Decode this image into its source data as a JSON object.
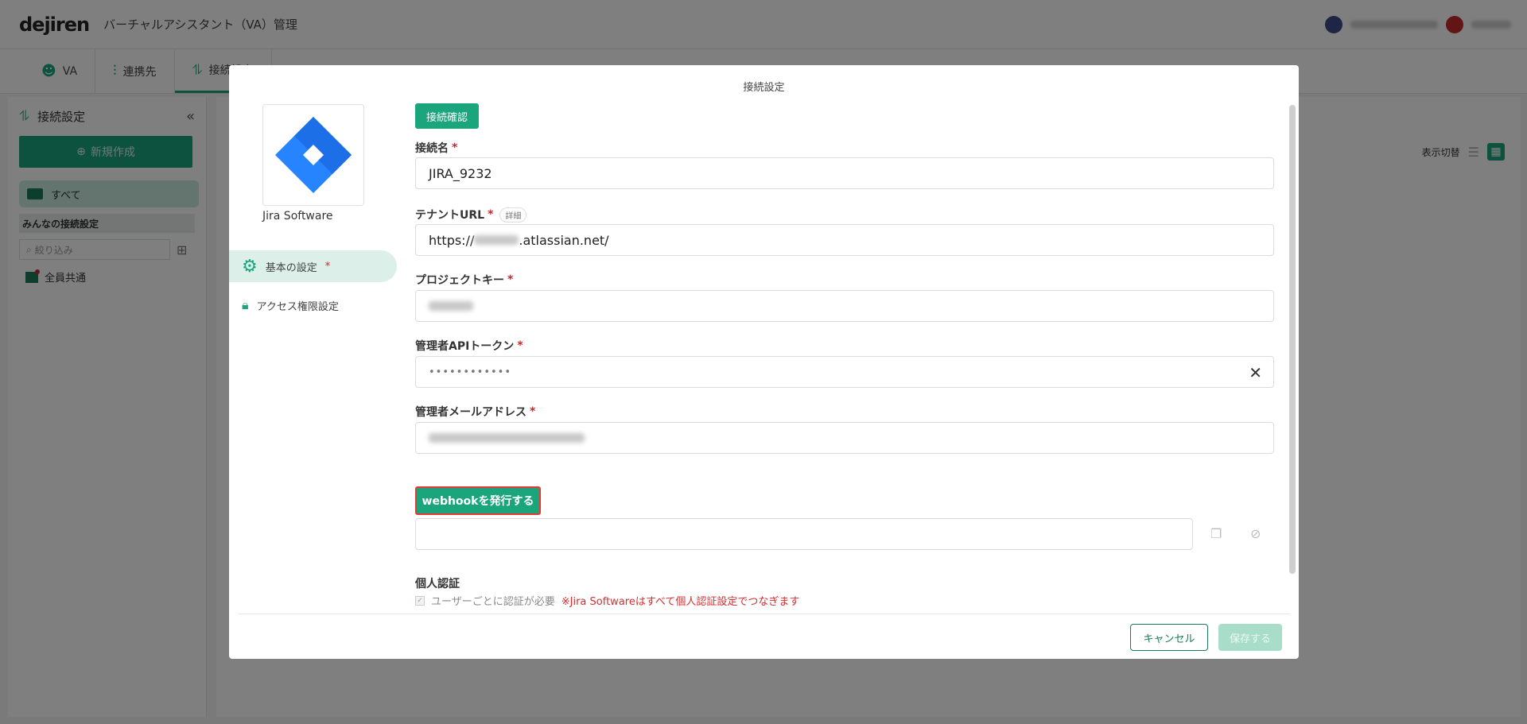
{
  "app": {
    "logo": "dejiren",
    "title": "バーチャルアシスタント（VA）管理"
  },
  "tabs": [
    {
      "label": "VA"
    },
    {
      "label": "連携先"
    },
    {
      "label": "接続設定"
    }
  ],
  "sidebar": {
    "title": "接続設定",
    "new_button": "新規作成",
    "all_label": "すべて",
    "section": "みんなの接続設定",
    "filter_placeholder": "絞り込み",
    "items": [
      {
        "label": "全員共通"
      }
    ]
  },
  "content": {
    "view_switch_label": "表示切替"
  },
  "modal": {
    "title": "接続設定",
    "service_name": "Jira Software",
    "nav": [
      {
        "label": "基本の設定",
        "required": "*"
      },
      {
        "label": "アクセス権限設定"
      }
    ],
    "confirm_button": "接続確認",
    "fields": {
      "connection_name": {
        "label": "接続名",
        "value": "JIRA_9232"
      },
      "tenant_url": {
        "label": "テナントURL",
        "detail": "詳細",
        "prefix": "https://",
        "suffix": ".atlassian.net/"
      },
      "project_key": {
        "label": "プロジェクトキー"
      },
      "api_token": {
        "label": "管理者APIトークン",
        "value": "••••••••••••"
      },
      "admin_email": {
        "label": "管理者メールアドレス"
      }
    },
    "required_mark": "*",
    "webhook_button": "webhookを発行する",
    "personal_auth": {
      "label": "個人認証",
      "checkbox_label": "ユーザーごとに認証が必要",
      "note": "※Jira Softwareはすべて個人認証設定でつなぎます"
    },
    "cancel_button": "キャンセル",
    "save_button": "保存する"
  },
  "colors": {
    "accent": "#1aa57d",
    "danger": "#c62828",
    "jira_blue": "#2684ff"
  }
}
